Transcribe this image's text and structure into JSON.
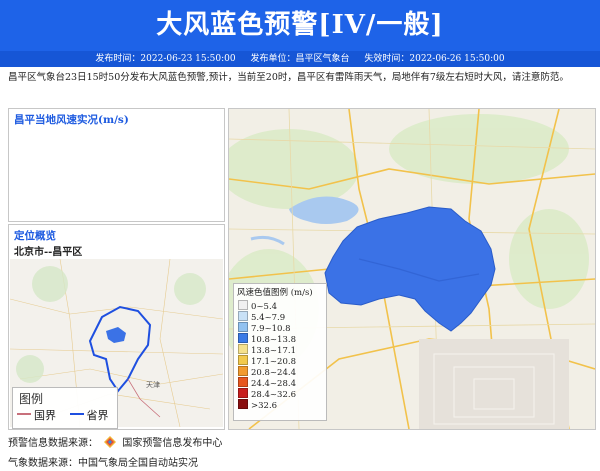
{
  "header": {
    "title": "大风蓝色预警[IV/一般]",
    "publish_time": "发布时间：2022-06-23 15:50:00",
    "publisher": "发布单位：昌平区气象台",
    "expire_time": "失效时间：2022-06-26 15:50:00"
  },
  "description": "昌平区气象台23日15时50分发布大风蓝色预警,预计，当前至20时，昌平区有雷阵雨天气，局地伴有7级左右短时大风，请注意防范。",
  "panels": {
    "wind_title": "昌平当地风速实况(m/s)",
    "location_title": "定位概览",
    "location_sub": "北京市--昌平区"
  },
  "inset_legend": {
    "title": "图例",
    "national_border": "国界",
    "provincial_border": "省界",
    "city_label": "天津"
  },
  "legend": {
    "title": "风速色值图例 (m/s)",
    "items": [
      {
        "label": "0~5.4",
        "color": "#f0f0f0"
      },
      {
        "label": "5.4~7.9",
        "color": "#c9e2f7"
      },
      {
        "label": "7.9~10.8",
        "color": "#92c2f0"
      },
      {
        "label": "10.8~13.8",
        "color": "#3b7be6"
      },
      {
        "label": "13.8~17.1",
        "color": "#f5e18c"
      },
      {
        "label": "17.1~20.8",
        "color": "#f2c94c"
      },
      {
        "label": "20.8~24.4",
        "color": "#f29a2e"
      },
      {
        "label": "24.4~28.4",
        "color": "#e8561e"
      },
      {
        "label": "28.4~32.6",
        "color": "#c81e1e"
      },
      {
        "label": ">32.6",
        "color": "#8a0f0f"
      }
    ]
  },
  "footer": {
    "warning_source_label": "预警信息数据来源：",
    "warning_source_name": "国家预警信息发布中心",
    "weather_source": "气象数据来源：中国气象局全国自动站实况"
  },
  "colors": {
    "banner": "#1e63e8",
    "district_fill": "#3b72e6"
  }
}
